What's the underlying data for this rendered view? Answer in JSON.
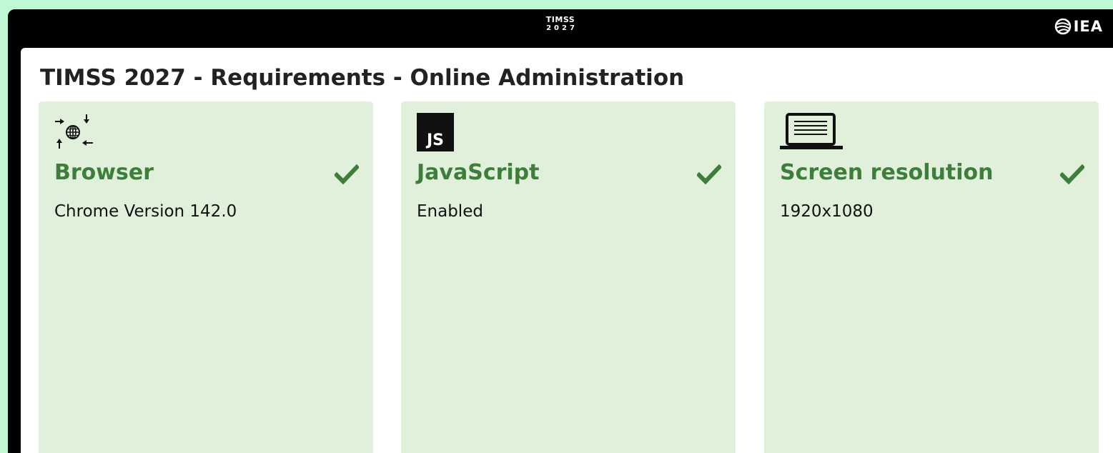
{
  "header": {
    "brand_line1": "TIMSS",
    "brand_line2": "2027",
    "org_logo": "IEA"
  },
  "page": {
    "title": "TIMSS 2027 - Requirements - Online Administration"
  },
  "cards": [
    {
      "icon": "browser-network-icon",
      "title": "Browser",
      "value": "Chrome Version 142.0",
      "status": "check"
    },
    {
      "icon": "javascript-icon",
      "title": "JavaScript",
      "value": "Enabled",
      "status": "check",
      "icon_text": "JS"
    },
    {
      "icon": "laptop-icon",
      "title": "Screen resolution",
      "value": "1920x1080",
      "status": "check"
    }
  ],
  "colors": {
    "page_background": "#bff9d4",
    "card_background": "#e0f0da",
    "accent_green": "#3c7e3a",
    "header_black": "#000000"
  }
}
